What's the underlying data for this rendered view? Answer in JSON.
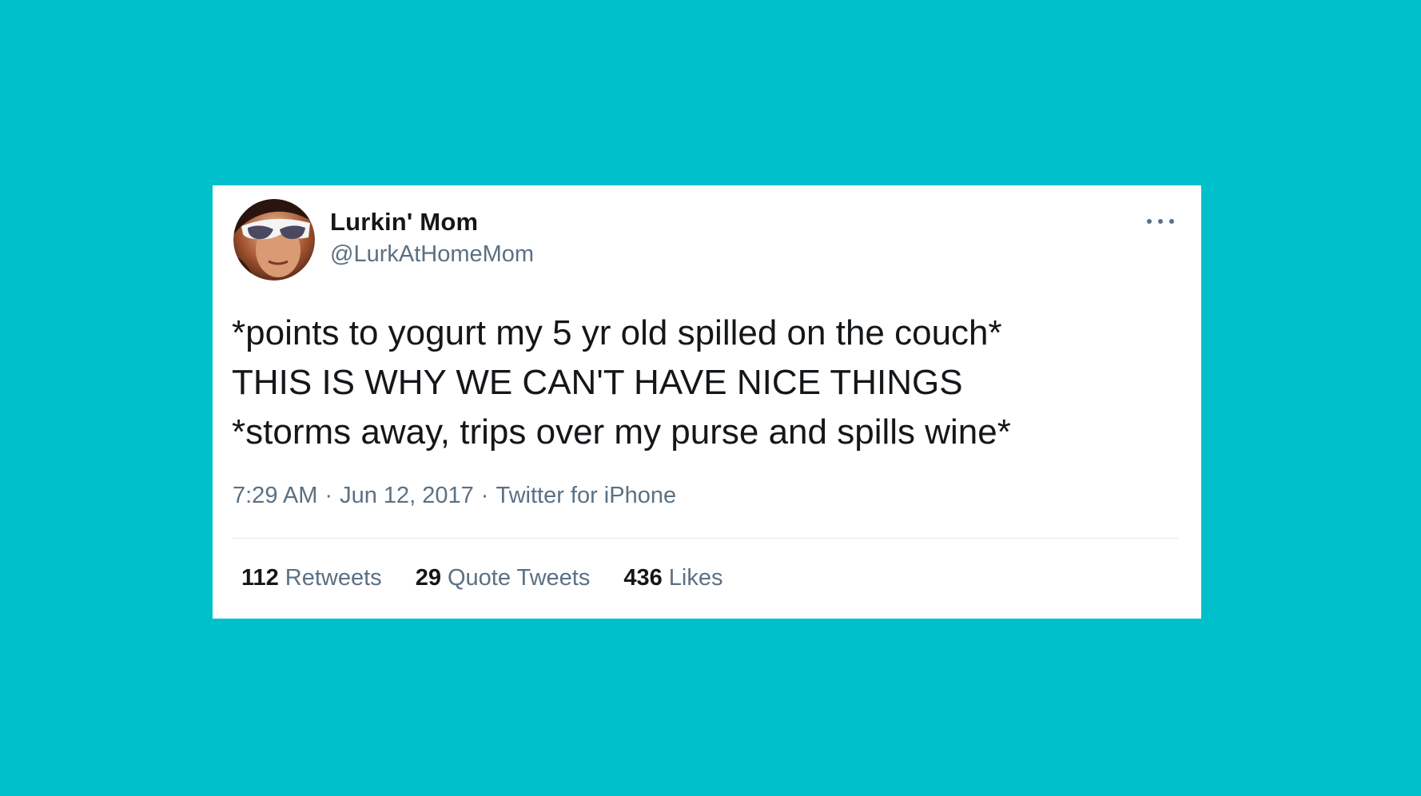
{
  "tweet": {
    "display_name": "Lurkin' Mom",
    "handle": "@LurkAtHomeMom",
    "text_lines": [
      "*points to yogurt my 5 yr old spilled on the couch*",
      "THIS IS WHY WE CAN'T HAVE NICE THINGS",
      "*storms away, trips over my purse and spills wine*"
    ],
    "time": "7:29 AM",
    "date": "Jun 12, 2017",
    "source": "Twitter for iPhone",
    "separator": "·",
    "stats": [
      {
        "count": "112",
        "label": "Retweets"
      },
      {
        "count": "29",
        "label": "Quote Tweets"
      },
      {
        "count": "436",
        "label": "Likes"
      }
    ],
    "more_icon": "more-horizontal-icon"
  },
  "colors": {
    "background": "#00c1cb",
    "card": "#ffffff",
    "primary_text": "#14171a",
    "secondary_text": "#5b7083",
    "divider": "#e1e8ed"
  }
}
